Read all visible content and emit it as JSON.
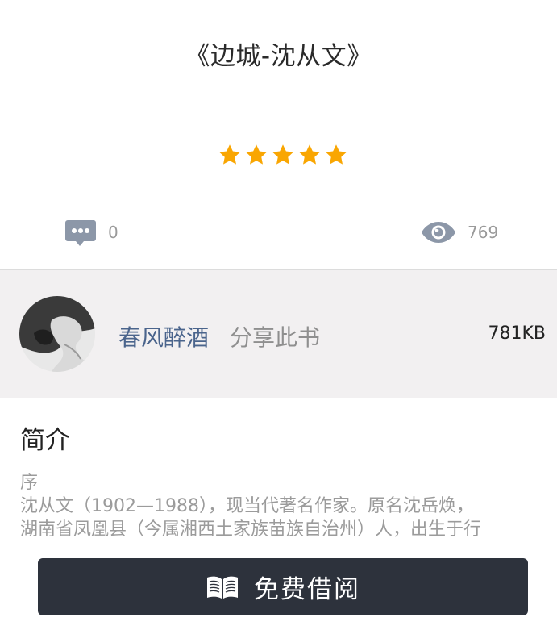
{
  "book": {
    "title": "《边城-沈从文》",
    "rating": 5,
    "rating_max": 5,
    "star_color": "#f9a602"
  },
  "stats": {
    "comment_icon": "comment-bubble-icon",
    "comment_count": "0",
    "view_icon": "eye-icon",
    "view_count": "769"
  },
  "share": {
    "sharer_name": "春风醉酒",
    "share_label": "分享此书",
    "file_size": "781KB",
    "avatar": "user-avatar"
  },
  "intro": {
    "heading": "简介",
    "lines": [
      "序",
      "沈从文（1902—1988），现当代著名作家。原名沈岳焕，",
      "湖南省凤凰县（今属湘西土家族苗族自治州）人，出生于行"
    ]
  },
  "actions": {
    "borrow_icon": "open-book-icon",
    "borrow_label": "免费借阅"
  },
  "colors": {
    "accent_link": "#4a648c",
    "button_bg": "#2d323c",
    "panel_bg": "#f2f0f1"
  }
}
